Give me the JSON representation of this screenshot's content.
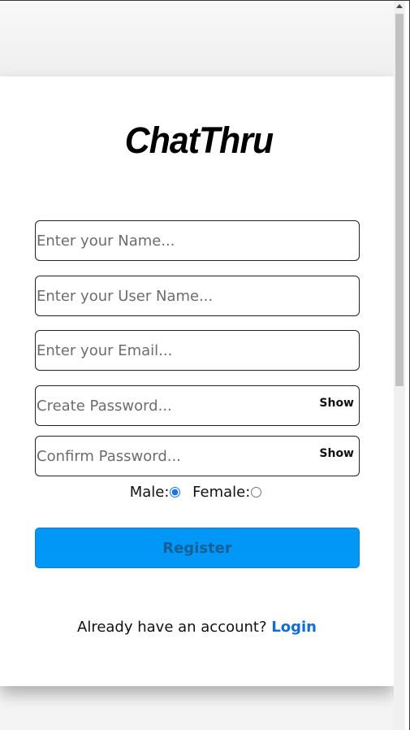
{
  "app": {
    "logo_text": "ChatThru"
  },
  "form": {
    "name": {
      "placeholder": "Enter your Name...",
      "value": ""
    },
    "username": {
      "placeholder": "Enter your User Name...",
      "value": ""
    },
    "email": {
      "placeholder": "Enter your Email...",
      "value": ""
    },
    "password": {
      "placeholder": "Create Password...",
      "value": "",
      "toggle_label": "Show"
    },
    "confirm_password": {
      "placeholder": "Confirm Password...",
      "value": "",
      "toggle_label": "Show"
    },
    "gender": {
      "male_label": "Male:",
      "female_label": "Female:",
      "selected": "male"
    },
    "register_label": "Register"
  },
  "footer": {
    "prompt": "Already have an account?",
    "login_label": "Login"
  },
  "colors": {
    "register_bg": "#0197f6",
    "register_text": "#166098",
    "login_link": "#0f6fd6",
    "radio_accent": "#1a73e8"
  }
}
